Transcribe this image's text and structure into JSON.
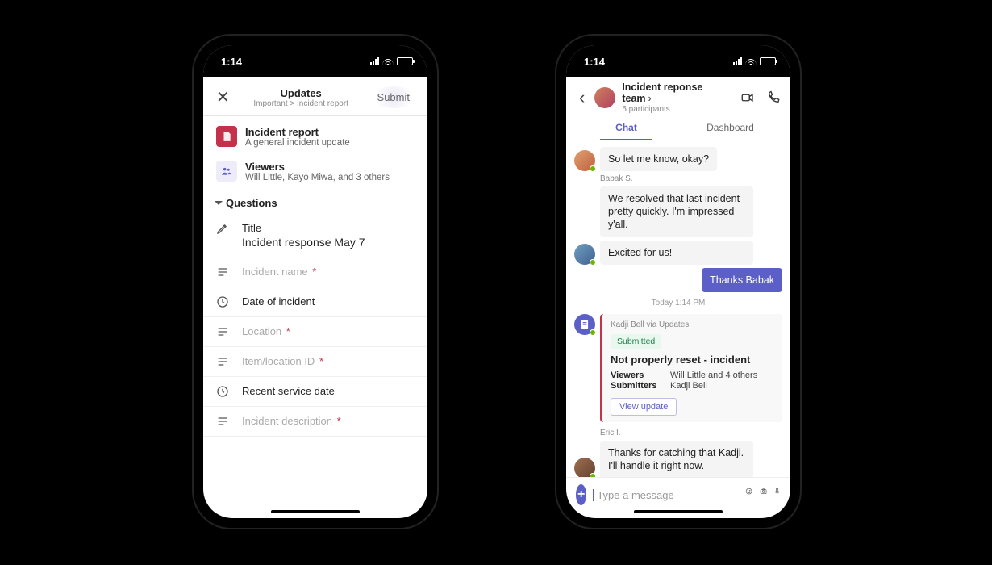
{
  "status": {
    "time": "1:14"
  },
  "leftPhone": {
    "header": {
      "title": "Updates",
      "breadcrumb": "Important > Incident report",
      "submit": "Submit"
    },
    "report": {
      "title": "Incident report",
      "subtitle": "A general incident update",
      "viewersLabel": "Viewers",
      "viewersValue": "Will Little, Kayo Miwa, and 3 others"
    },
    "sectionLabel": "Questions",
    "fields": {
      "title": {
        "label": "Title",
        "value": "Incident response May 7"
      },
      "incidentName": {
        "label": "Incident name"
      },
      "dateOfIncident": {
        "label": "Date of incident"
      },
      "location": {
        "label": "Location"
      },
      "itemLocationId": {
        "label": "Item/location ID"
      },
      "recentServiceDate": {
        "label": "Recent service date"
      },
      "incidentDescription": {
        "label": "Incident description"
      }
    },
    "requiredMark": "*"
  },
  "rightPhone": {
    "header": {
      "title": "Incident reponse team",
      "subtitle": "5 participants"
    },
    "tabs": {
      "chat": "Chat",
      "dashboard": "Dashboard"
    },
    "messages": {
      "m1": "So let me know, okay?",
      "sender2": "Babak S.",
      "m2": "We resolved that last incident pretty quickly. I'm impressed y'all.",
      "m3": "Excited for us!",
      "m4": "Thanks Babak",
      "timeDivider": "Today 1:14 PM",
      "cardVia": "Kadji Bell via Updates",
      "cardBadge": "Submitted",
      "cardTitle": "Not properly reset - incident",
      "cardViewersK": "Viewers",
      "cardViewersV": "Will Little and 4 others",
      "cardSubmittersK": "Submitters",
      "cardSubmittersV": "Kadji Bell",
      "cardButton": "View update",
      "sender5": "Eric I.",
      "m5": "Thanks for catching that Kadji. I'll handle it right now."
    },
    "compose": {
      "placeholder": "Type a message"
    }
  }
}
